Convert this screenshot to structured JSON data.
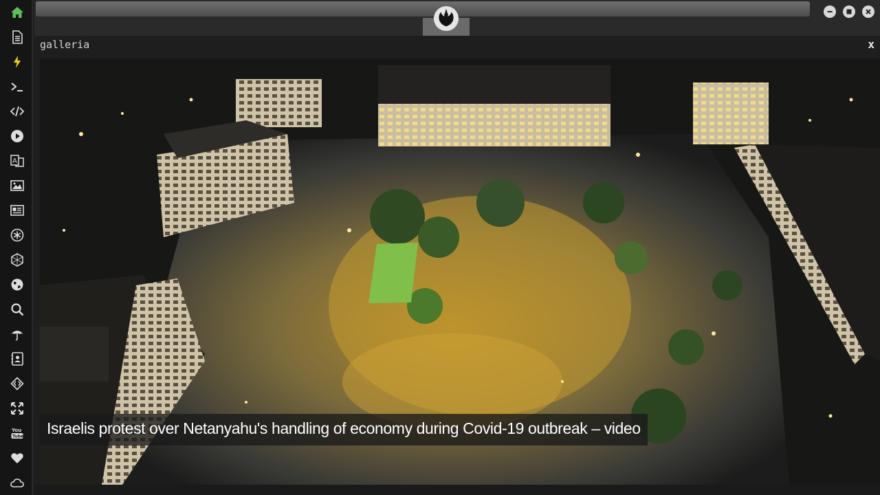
{
  "sidebar": {
    "items": [
      {
        "icon": "home-icon",
        "color": "#5cc15c"
      },
      {
        "icon": "document-icon"
      },
      {
        "icon": "lightning-icon"
      },
      {
        "icon": "terminal-icon"
      },
      {
        "icon": "code-icon"
      },
      {
        "icon": "play-icon"
      },
      {
        "icon": "translate-icon"
      },
      {
        "icon": "image-icon"
      },
      {
        "icon": "news-icon"
      },
      {
        "icon": "asterisk-icon"
      },
      {
        "icon": "hexagon-icon"
      },
      {
        "icon": "globe-icon"
      },
      {
        "icon": "search-icon"
      },
      {
        "icon": "umbrella-icon"
      },
      {
        "icon": "contact-icon"
      },
      {
        "icon": "link-code-icon"
      },
      {
        "icon": "expand-icon"
      },
      {
        "icon": "youtube-icon"
      },
      {
        "icon": "heart-icon"
      },
      {
        "icon": "cloud-icon"
      }
    ]
  },
  "window": {
    "logo": "rebel-alliance-logo",
    "buttons": [
      "minimize-icon",
      "maximize-icon",
      "close-icon"
    ]
  },
  "panel": {
    "title": "galleria",
    "close_label": "x"
  },
  "gallery": {
    "caption": "Israelis protest over Netanyahu's handling of economy during Covid-19 outbreak – video"
  }
}
